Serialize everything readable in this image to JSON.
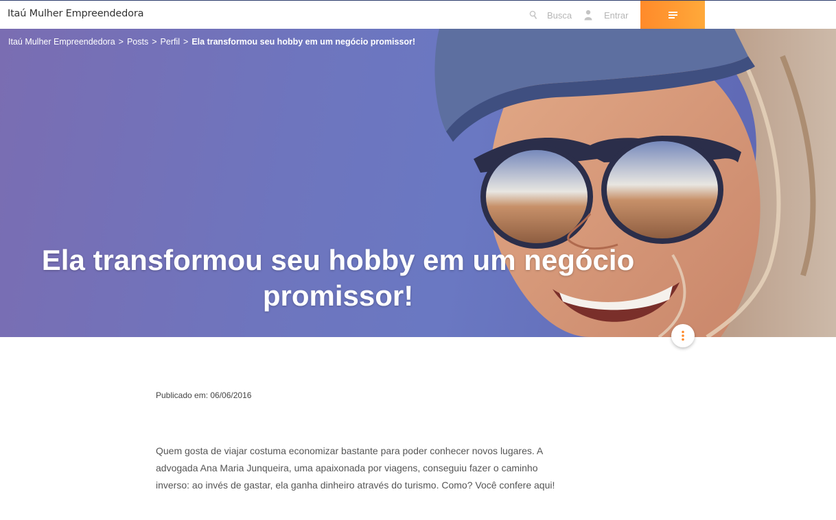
{
  "header": {
    "brand": "Itaú Mulher Empreendedora",
    "search_label": "Busca",
    "login_label": "Entrar",
    "menu_icon": "hamburger-menu-icon",
    "accent_color": "#ff9a2f"
  },
  "breadcrumb": {
    "items": [
      "Itaú Mulher Empreendedora",
      "Posts",
      "Perfil"
    ],
    "separator": ">",
    "current": "Ela transformou seu hobby em um negócio promissor!"
  },
  "hero": {
    "title_line1": "Ela transformou seu hobby em um negócio",
    "title_line2": "promissor!",
    "share_icon": "vertical-dots-icon"
  },
  "article": {
    "published": "Publicado em: 06/06/2016",
    "intro": "Quem gosta de viajar costuma economizar bastante para poder conhecer novos lugares. A advogada Ana Maria Junqueira, uma apaixonada por viagens, conseguiu fazer o caminho inverso: ao invés de gastar, ela ganha dinheiro através do turismo. Como? Você confere aqui!"
  }
}
